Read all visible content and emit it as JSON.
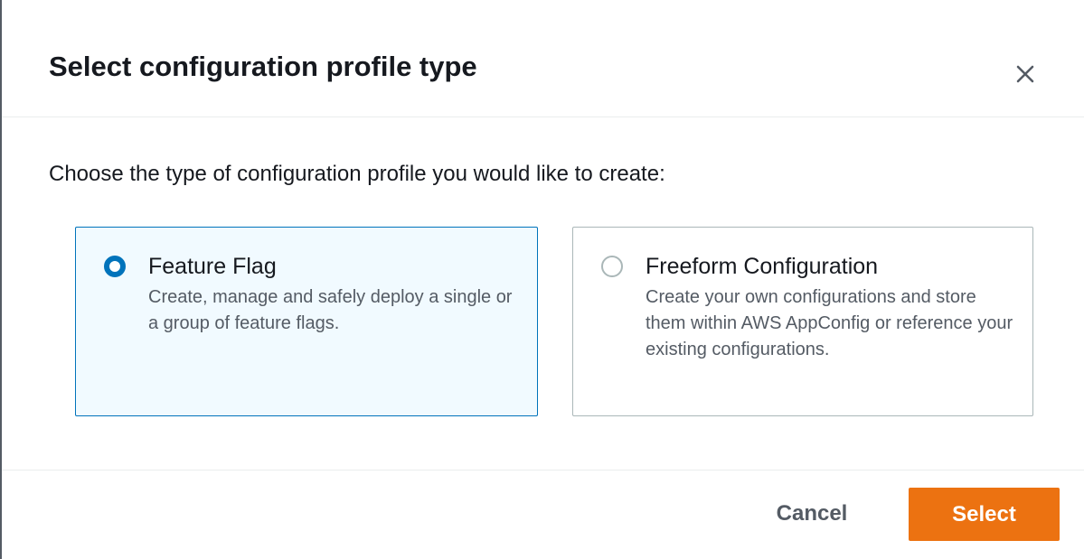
{
  "modal": {
    "title": "Select configuration profile type",
    "close_icon": "close-icon"
  },
  "body": {
    "instruction": "Choose the type of configuration profile you would like to create:",
    "options": [
      {
        "label": "Feature Flag",
        "description": "Create, manage and safely deploy a single or a group of feature flags.",
        "selected": true
      },
      {
        "label": "Freeform Configuration",
        "description": "Create your own configurations and store them within AWS AppConfig or reference your existing configurations.",
        "selected": false
      }
    ]
  },
  "footer": {
    "cancel_label": "Cancel",
    "select_label": "Select"
  },
  "colors": {
    "accent_blue": "#0073bb",
    "primary_orange": "#ec7211",
    "selected_tile_bg": "#f1faff",
    "text_primary": "#16191f",
    "text_secondary": "#545b64"
  }
}
